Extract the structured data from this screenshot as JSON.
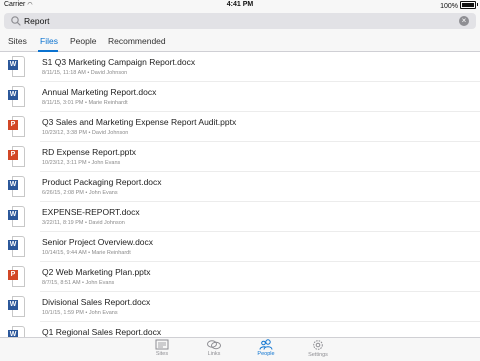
{
  "status_bar": {
    "carrier": "Carrier",
    "time": "4:41 PM",
    "battery": "100%"
  },
  "search": {
    "query": "Report",
    "clear_icon": "clear-icon"
  },
  "tabs": [
    {
      "label": "Sites",
      "active": false
    },
    {
      "label": "Files",
      "active": true
    },
    {
      "label": "People",
      "active": false
    },
    {
      "label": "Recommended",
      "active": false
    }
  ],
  "files": [
    {
      "name": "S1 Q3 Marketing Campaign Report.docx",
      "meta": "8/11/15, 11:18 AM • David Johnson",
      "type": "word"
    },
    {
      "name": "Annual Marketing Report.docx",
      "meta": "8/11/15, 3:01 PM • Marie Reinhardt",
      "type": "word"
    },
    {
      "name": "Q3 Sales and Marketing Expense Report Audit.pptx",
      "meta": "10/23/12, 3:38 PM • David Johnson",
      "type": "ppt"
    },
    {
      "name": "RD Expense Report.pptx",
      "meta": "10/23/12, 3:11 PM • John Evans",
      "type": "ppt"
    },
    {
      "name": "Product Packaging Report.docx",
      "meta": "6/26/15, 2:08 PM • John Evans",
      "type": "word"
    },
    {
      "name": "EXPENSE-REPORT.docx",
      "meta": "3/22/11, 8:19 PM • David Johnson",
      "type": "word"
    },
    {
      "name": "Senior Project Overview.docx",
      "meta": "10/14/15, 9:44 AM • Marie Reinhardt",
      "type": "word"
    },
    {
      "name": "Q2 Web Marketing Plan.pptx",
      "meta": "8/7/15, 8:51 AM • John Evans",
      "type": "ppt"
    },
    {
      "name": "Divisional Sales Report.docx",
      "meta": "10/1/15, 1:59 PM • John Evans",
      "type": "word"
    },
    {
      "name": "Q1 Regional Sales Report.docx",
      "meta": "",
      "type": "word"
    }
  ],
  "bottom_tabs": [
    {
      "label": "Sites",
      "icon": "sites-icon",
      "active": false
    },
    {
      "label": "Links",
      "icon": "links-icon",
      "active": false
    },
    {
      "label": "People",
      "icon": "people-icon",
      "active": true
    },
    {
      "label": "Settings",
      "icon": "settings-icon",
      "active": false
    }
  ],
  "colors": {
    "accent": "#0a72d0",
    "word": "#2b579a",
    "powerpoint": "#d24726"
  }
}
